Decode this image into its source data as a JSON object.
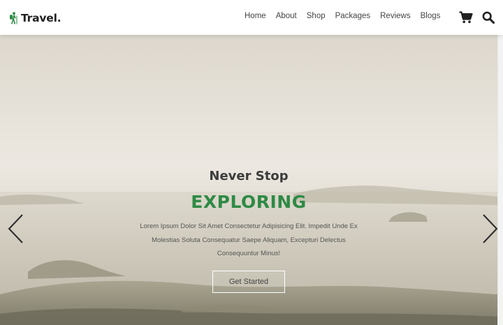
{
  "header": {
    "brand": "Travel.",
    "logo_icon": "hiker-icon",
    "nav": [
      "Home",
      "About",
      "Shop",
      "Packages",
      "Reviews",
      "Blogs"
    ],
    "cart_icon": "shopping-cart-icon",
    "search_icon": "search-icon"
  },
  "hero": {
    "subtitle": "Never Stop",
    "title": "EXPLORING",
    "text": "Lorem Ipsum Dolor Sit Amet Consectetur Adipisicing Elit. Impedit Unde Ex Molestias Soluta Consequatur Saepe Aliquam, Excepturi Delectus Consequuntur Minus!",
    "cta_label": "Get Started",
    "prev_icon": "chevron-left-icon",
    "next_icon": "chevron-right-icon"
  },
  "colors": {
    "accent": "#2e8a45",
    "text_dark": "#222222",
    "nav_text": "#444444"
  }
}
